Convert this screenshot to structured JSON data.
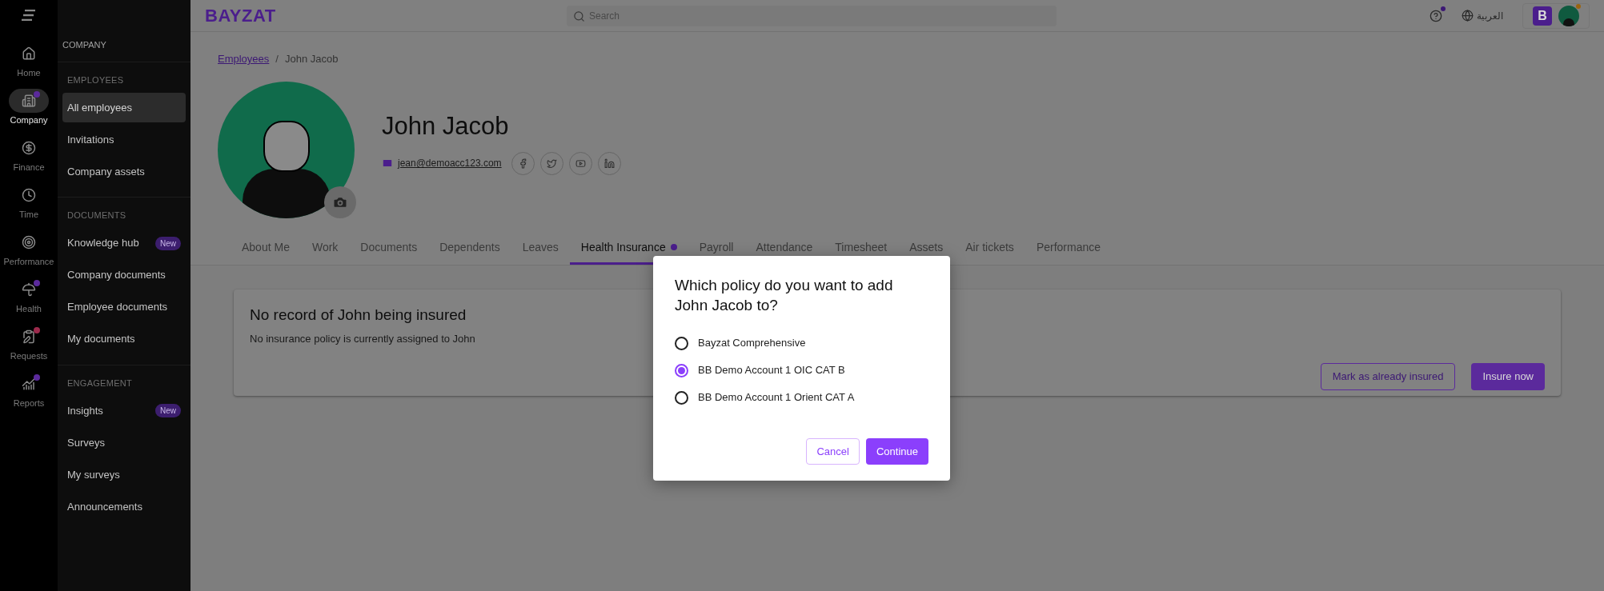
{
  "rail": {
    "items": [
      {
        "label": "Home",
        "selected": false
      },
      {
        "label": "Company",
        "selected": true,
        "color": "#5b2a9c"
      },
      {
        "label": "Finance",
        "selected": false
      },
      {
        "label": "Time",
        "selected": false
      },
      {
        "label": "Performance",
        "selected": false
      },
      {
        "label": "Health",
        "selected": false,
        "color": "#5b2a9c"
      },
      {
        "label": "Requests",
        "selected": false,
        "color": "#9c2a4c"
      },
      {
        "label": "Reports",
        "selected": false,
        "color": "#5b2a9c"
      }
    ]
  },
  "sidebar": {
    "title": "COMPANY",
    "sections": [
      {
        "heading": "EMPLOYEES",
        "items": [
          {
            "label": "All employees",
            "selected": true
          },
          {
            "label": "Invitations",
            "selected": false
          },
          {
            "label": "Company assets",
            "selected": false
          }
        ]
      },
      {
        "heading": "DOCUMENTS",
        "items": [
          {
            "label": "Knowledge hub",
            "selected": false,
            "badge": "New"
          },
          {
            "label": "Company documents",
            "selected": false
          },
          {
            "label": "Employee documents",
            "selected": false
          },
          {
            "label": "My documents",
            "selected": false
          }
        ]
      },
      {
        "heading": "ENGAGEMENT",
        "items": [
          {
            "label": "Insights",
            "selected": false,
            "badge": "New"
          },
          {
            "label": "Surveys",
            "selected": false
          },
          {
            "label": "My surveys",
            "selected": false
          },
          {
            "label": "Announcements",
            "selected": false
          }
        ]
      }
    ]
  },
  "topbar": {
    "logo": "BAYZAT",
    "search": {
      "placeholder": "Search"
    },
    "help": {
      "notification": true
    },
    "language": "العربية",
    "account": {
      "badge": "B",
      "notification": true
    }
  },
  "breadcrumb": {
    "link": "Employees",
    "separator": "/",
    "current": "John Jacob"
  },
  "profile": {
    "name": "John Jacob",
    "email": "jean@demoacc123.com"
  },
  "tabs": [
    {
      "label": "About Me",
      "selected": false
    },
    {
      "label": "Work",
      "selected": false
    },
    {
      "label": "Documents",
      "selected": false
    },
    {
      "label": "Dependents",
      "selected": false
    },
    {
      "label": "Leaves",
      "selected": false
    },
    {
      "label": "Health Insurance",
      "selected": true,
      "color": "#4b1e8c"
    },
    {
      "label": "Payroll",
      "selected": false
    },
    {
      "label": "Attendance",
      "selected": false
    },
    {
      "label": "Timesheet",
      "selected": false
    },
    {
      "label": "Assets",
      "selected": false
    },
    {
      "label": "Air tickets",
      "selected": false
    },
    {
      "label": "Performance",
      "selected": false
    }
  ],
  "card": {
    "title": "No record of John being insured",
    "text": "No insurance policy is currently assigned to John",
    "buttons": [
      "Mark as already insured",
      "Insure now"
    ]
  },
  "dialog": {
    "title": "Which policy do you want to add John Jacob to?",
    "options": [
      {
        "label": "Bayzat Comprehensive",
        "selected": false
      },
      {
        "label": "BB Demo Account 1 OIC CAT B",
        "selected": true
      },
      {
        "label": "BB Demo Account 1 Orient CAT A",
        "selected": false
      }
    ],
    "buttons": [
      "Cancel",
      "Continue"
    ]
  }
}
